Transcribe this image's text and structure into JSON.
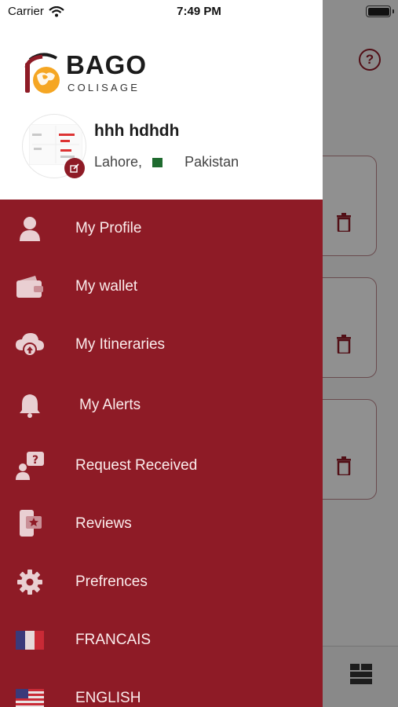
{
  "status_bar": {
    "carrier": "Carrier",
    "time": "7:49 PM"
  },
  "header": {
    "brand": "BAGO",
    "brand_sub": "COLISAGE",
    "user_name": "hhh hdhdh",
    "city": "Lahore,",
    "country": "Pakistan"
  },
  "menu": {
    "items": [
      {
        "label": "My Profile",
        "icon": "user-icon"
      },
      {
        "label": "My wallet",
        "icon": "wallet-icon"
      },
      {
        "label": "My Itineraries",
        "icon": "cloud-upload-icon"
      },
      {
        "label": "My Alerts",
        "icon": "bell-icon"
      },
      {
        "label": "Request Received",
        "icon": "request-question-icon"
      },
      {
        "label": "Reviews",
        "icon": "reviews-phone-star-icon"
      },
      {
        "label": "Prefrences",
        "icon": "gear-icon"
      },
      {
        "label": "FRANCAIS",
        "icon": "flag-france-icon"
      },
      {
        "label": "ENGLISH",
        "icon": "flag-usa-icon"
      }
    ]
  },
  "colors": {
    "accent": "#8e1b26",
    "menu_text": "#fbecec"
  }
}
